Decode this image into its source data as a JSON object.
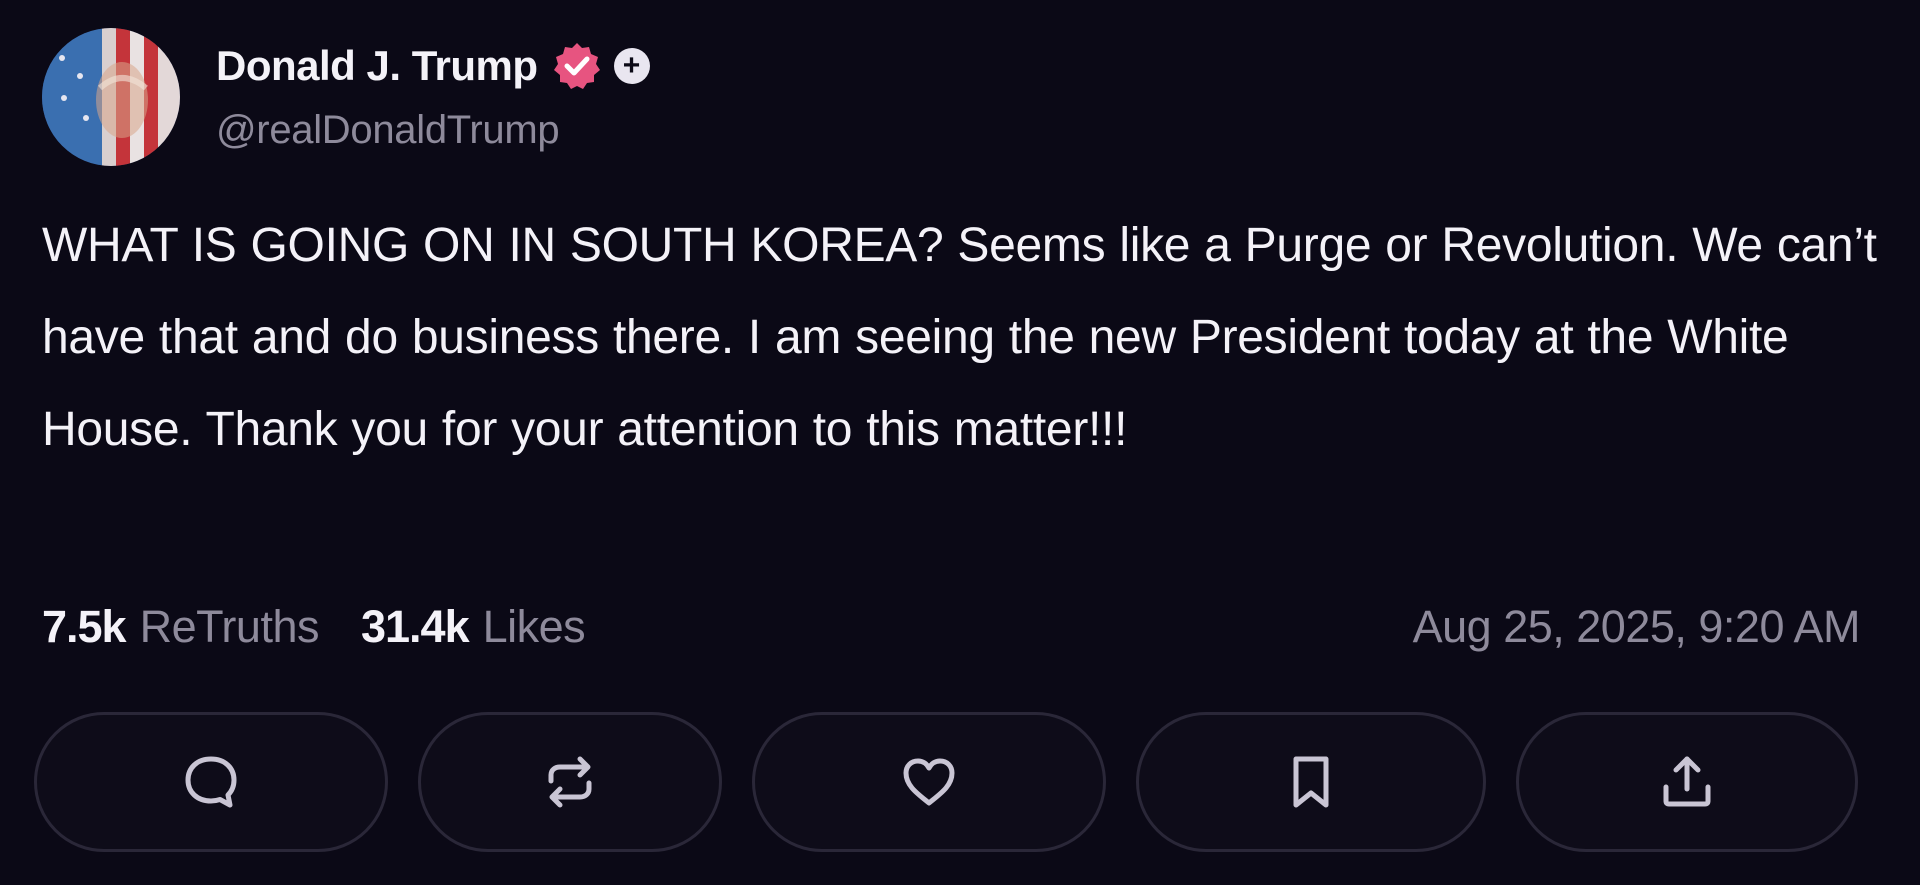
{
  "author": {
    "display_name": "Donald J. Trump",
    "handle": "@realDonaldTrump",
    "verified_icon": "verified-badge-icon",
    "plus_badge": "+"
  },
  "post": {
    "text": "WHAT IS GOING ON IN SOUTH KOREA? Seems like a Purge or Revolution. We can’t have that and do business there. I am seeing the new President today at the White House. Thank you for your attention to this matter!!!"
  },
  "stats": {
    "retruths_count": "7.5k",
    "retruths_label": "ReTruths",
    "likes_count": "31.4k",
    "likes_label": "Likes",
    "timestamp": "Aug 25, 2025, 9:20 AM"
  },
  "actions": [
    {
      "name": "reply",
      "icon": "comment-icon"
    },
    {
      "name": "retruth",
      "icon": "repost-icon"
    },
    {
      "name": "like",
      "icon": "heart-icon"
    },
    {
      "name": "bookmark",
      "icon": "bookmark-icon"
    },
    {
      "name": "share",
      "icon": "share-icon"
    }
  ],
  "colors": {
    "background": "#0b0916",
    "text": "#f4f2f8",
    "muted": "#8e8a9b",
    "verified": "#e75480",
    "button_border": "#2a2738"
  }
}
